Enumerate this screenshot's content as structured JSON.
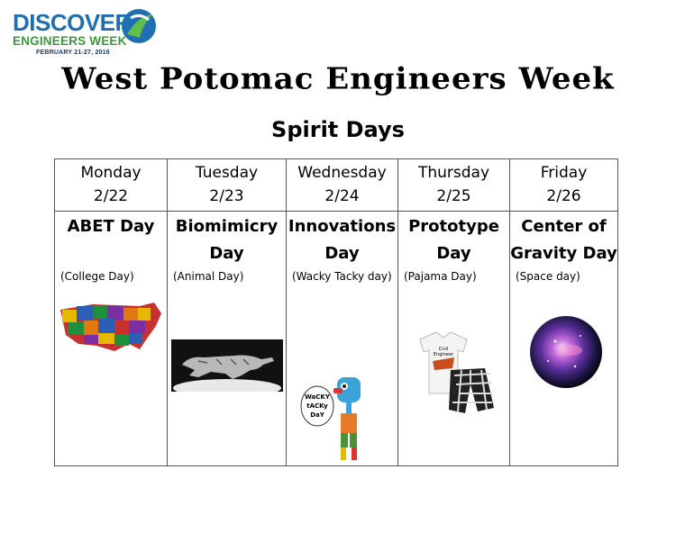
{
  "logo": {
    "word1": "DISCOVER",
    "word2": "ENGINEERS WEEK",
    "dates": "FEBRUARY 21-27, 2016"
  },
  "title": "West Potomac Engineers Week",
  "subtitle": "Spirit Days",
  "days": [
    {
      "day": "Monday",
      "date": "2/22",
      "theme": "ABET Day",
      "sub": "(College Day)",
      "image": "usa-map-collage"
    },
    {
      "day": "Tuesday",
      "date": "2/23",
      "theme": "Biomimicry Day",
      "sub": "(Animal Day)",
      "image": "cheetah-sculpture"
    },
    {
      "day": "Wednesday",
      "date": "2/24",
      "theme": "Innovations Day",
      "sub": "(Wacky Tacky day)",
      "image": "wacky-tacky-character",
      "image_text": "WaCKY tACKy DaY"
    },
    {
      "day": "Thursday",
      "date": "2/25",
      "theme": "Prototype Day",
      "sub": "(Pajama Day)",
      "image": "pajamas",
      "image_text": "Civil Engineer"
    },
    {
      "day": "Friday",
      "date": "2/26",
      "theme": "Center of Gravity Day",
      "sub": "(Space day)",
      "image": "galaxy-sphere"
    }
  ],
  "colors": {
    "logo_blue": "#1f6fb2",
    "logo_green": "#3a9a3a",
    "border": "#555555"
  }
}
